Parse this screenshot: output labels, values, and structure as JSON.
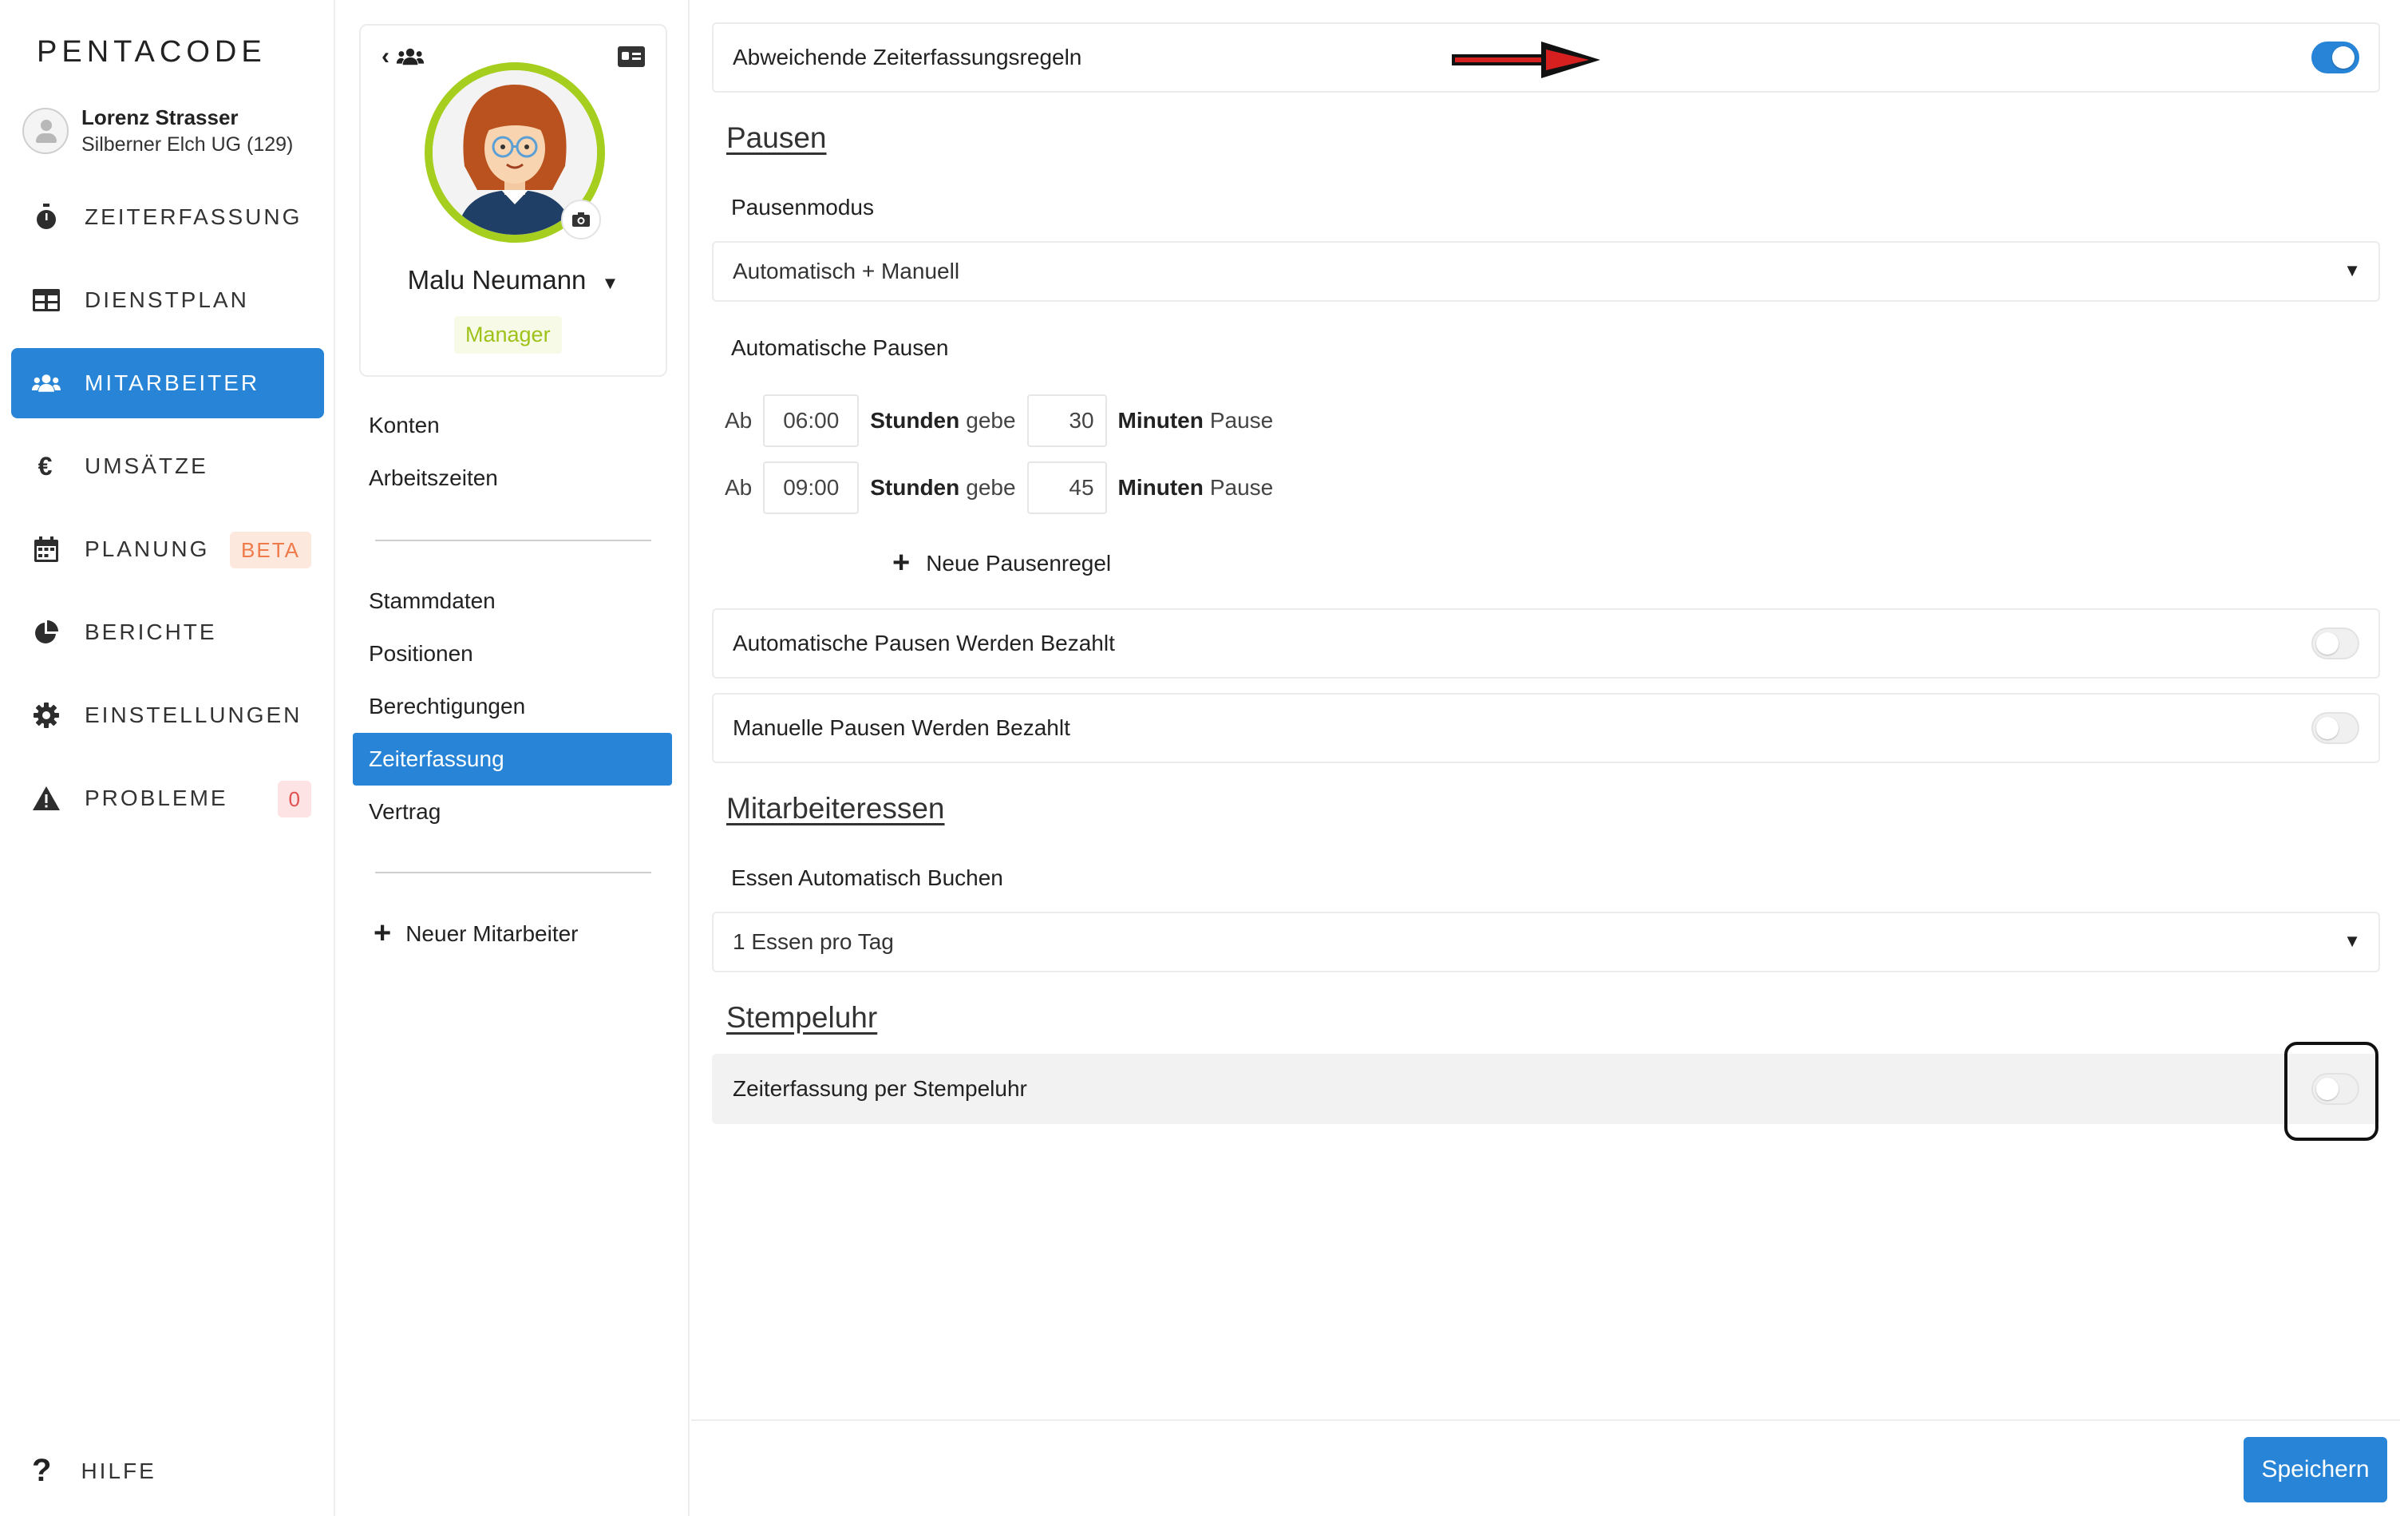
{
  "sidebar": {
    "logo": "PENTACODE",
    "user": {
      "name": "Lorenz Strasser",
      "company": "Silberner Elch UG (129)"
    },
    "nav": [
      {
        "label": "ZEITERFASSUNG",
        "icon": "stopwatch-icon",
        "active": false
      },
      {
        "label": "DIENSTPLAN",
        "icon": "table-icon",
        "active": false
      },
      {
        "label": "MITARBEITER",
        "icon": "users-icon",
        "active": true
      },
      {
        "label": "UMSÄTZE",
        "icon": "euro-icon",
        "active": false
      },
      {
        "label": "PLANUNG",
        "icon": "calendar-icon",
        "active": false,
        "badge": "BETA"
      },
      {
        "label": "BERICHTE",
        "icon": "pie-chart-icon",
        "active": false
      },
      {
        "label": "EINSTELLUNGEN",
        "icon": "gear-icon",
        "active": false
      },
      {
        "label": "PROBLEME",
        "icon": "warning-icon",
        "active": false,
        "badge": "0"
      }
    ],
    "help": "HILFE"
  },
  "profile": {
    "name": "Malu Neumann",
    "role": "Manager",
    "menu_top": [
      "Konten",
      "Arbeitszeiten"
    ],
    "menu_main": [
      "Stammdaten",
      "Positionen",
      "Berechtigungen",
      "Zeiterfassung",
      "Vertrag"
    ],
    "active_item": "Zeiterfassung",
    "new_employee": "Neuer Mitarbeiter"
  },
  "main": {
    "custom_rules": {
      "label": "Abweichende Zeiterfassungsregeln",
      "enabled": true
    },
    "pausen": {
      "title": "Pausen",
      "mode_label": "Pausenmodus",
      "mode_value": "Automatisch + Manuell",
      "auto_label": "Automatische Pausen",
      "rules": [
        {
          "ab": "Ab",
          "hours": "06:00",
          "hours_label": "Stunden",
          "give": "gebe",
          "minutes": "30",
          "minutes_label": "Minuten",
          "pause": "Pause"
        },
        {
          "ab": "Ab",
          "hours": "09:00",
          "hours_label": "Stunden",
          "give": "gebe",
          "minutes": "45",
          "minutes_label": "Minuten",
          "pause": "Pause"
        }
      ],
      "new_rule": "Neue Pausenregel",
      "auto_paid": {
        "label": "Automatische Pausen Werden Bezahlt",
        "enabled": false
      },
      "manual_paid": {
        "label": "Manuelle Pausen Werden Bezahlt",
        "enabled": false
      }
    },
    "meals": {
      "title": "Mitarbeiteressen",
      "auto_label": "Essen Automatisch Buchen",
      "value": "1 Essen pro Tag"
    },
    "clock": {
      "title": "Stempeluhr",
      "row": {
        "label": "Zeiterfassung per Stempeluhr",
        "enabled": false
      }
    },
    "save": "Speichern"
  },
  "colors": {
    "accent": "#2784d6",
    "role_green": "#a6ce1f",
    "beta": "#ef7a4a",
    "error": "#e05050"
  }
}
